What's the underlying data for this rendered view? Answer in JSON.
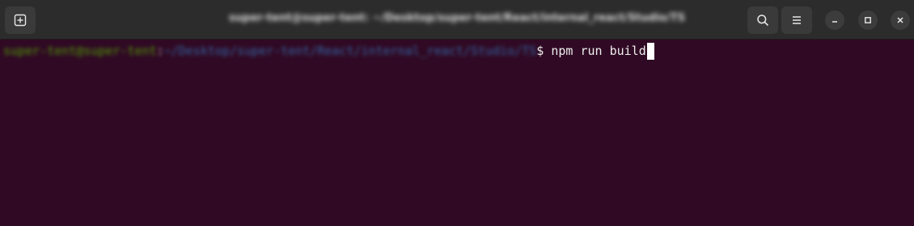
{
  "window": {
    "title": "super-tent@super-tent: ~/Desktop/super-tent/React/internal_react/Studio/TS"
  },
  "titlebar": {
    "new_tab_icon": "new-tab-icon",
    "search_icon": "search-icon",
    "menu_icon": "hamburger-menu-icon",
    "minimize_icon": "minimize-icon",
    "maximize_icon": "maximize-icon",
    "close_icon": "close-icon"
  },
  "terminal": {
    "prompt_user": "super-tent@super-tent",
    "prompt_separator": ":",
    "prompt_path": "~/Desktop/super-tent/React/internal_react/Studio/TS",
    "prompt_symbol": "$",
    "command": " npm run build",
    "colors": {
      "background": "#300a24",
      "user": "#4e9a06",
      "path": "#3465a4",
      "text": "#eeeeec"
    }
  }
}
